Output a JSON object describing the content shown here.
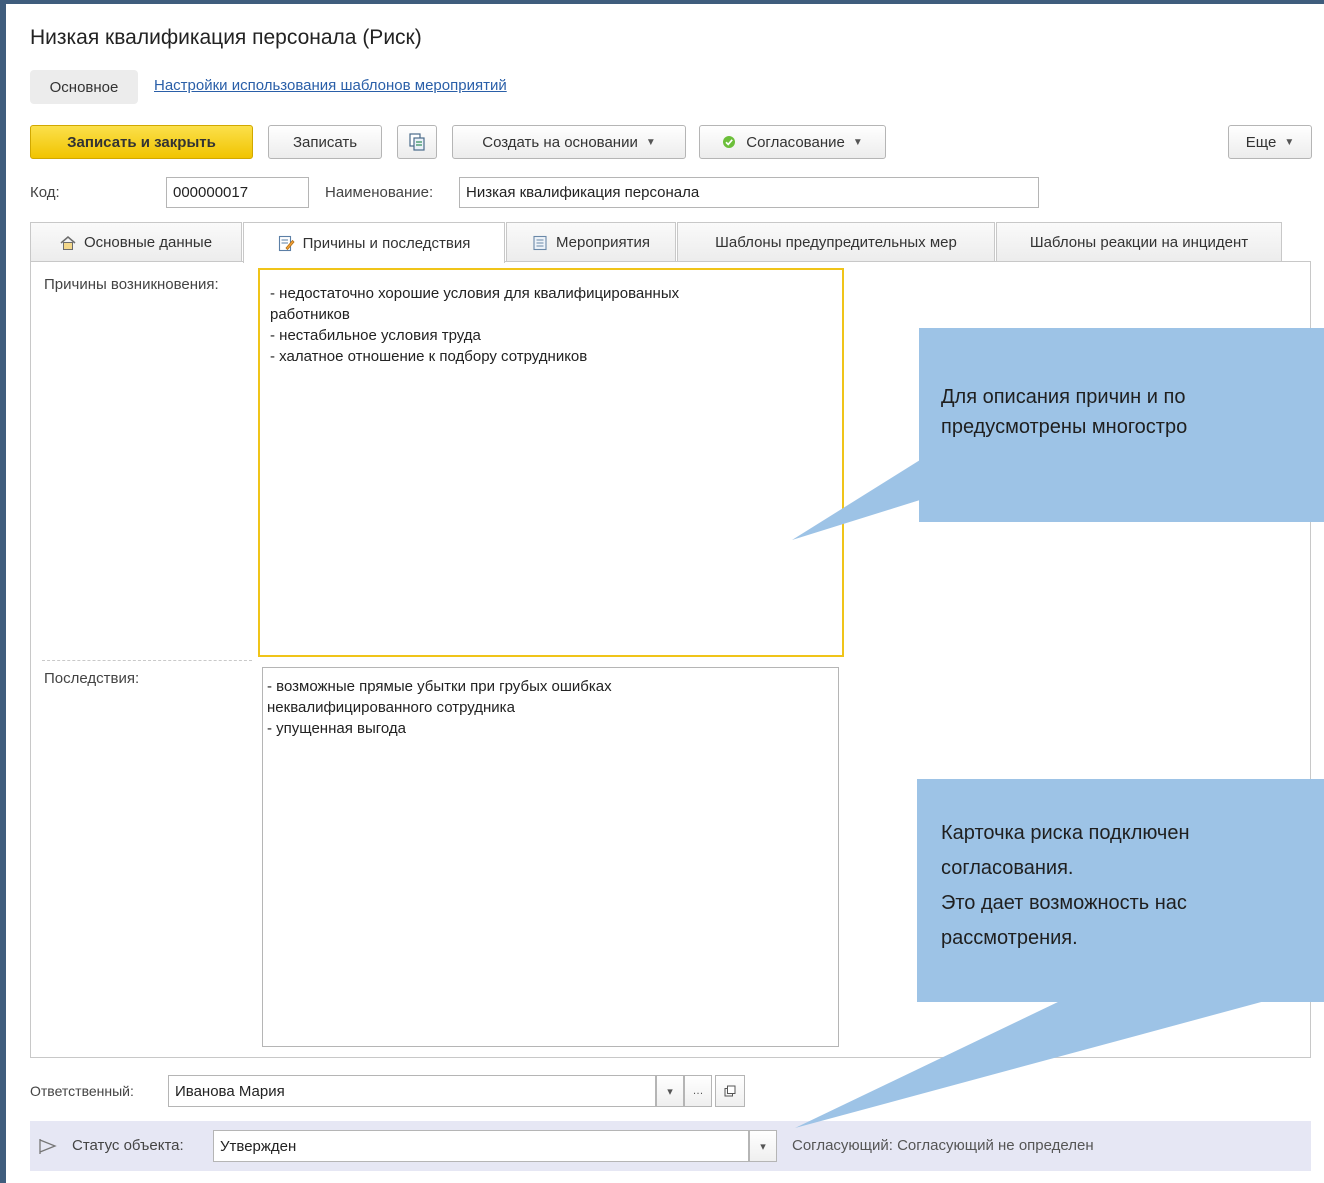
{
  "window": {
    "title": "Низкая квалификация персонала (Риск)"
  },
  "nav": {
    "active_tab": "Основное",
    "link": "Настройки использования шаблонов мероприятий"
  },
  "toolbar": {
    "save_close_label": "Записать и закрыть",
    "save_label": "Записать",
    "create_based_label": "Создать на основании",
    "approval_label": "Согласование",
    "more_label": "Еще"
  },
  "header_fields": {
    "code_label": "Код:",
    "code_value": "000000017",
    "name_label": "Наименование:",
    "name_value": "Низкая квалификация персонала"
  },
  "tabs": [
    {
      "label": "Основные данные",
      "icon": "house-icon"
    },
    {
      "label": "Причины и последствия",
      "icon": "edit-document-icon",
      "active": true
    },
    {
      "label": "Мероприятия",
      "icon": "list-document-icon"
    },
    {
      "label": "Шаблоны предупредительных мер"
    },
    {
      "label": "Шаблоны реакции на инцидент"
    }
  ],
  "causes": {
    "label": "Причины возникновения:",
    "text": "- недостаточно хорошие условия для квалифицированных\nработников\n- нестабильное условия труда\n- халатное отношение к подбору сотрудников"
  },
  "consequences": {
    "label": "Последствия:",
    "text": "- возможные прямые убытки при грубых ошибках\nнеквалифицированного сотрудника\n- упущенная выгода"
  },
  "responsible": {
    "label": "Ответственный:",
    "value": "Иванова Мария"
  },
  "status": {
    "label": "Статус объекта:",
    "value": "Утвержден",
    "approver": "Согласующий: Согласующий не определен"
  },
  "callouts": [
    {
      "lines": [
        "Для описания причин и по",
        "предусмотрены многостро"
      ]
    },
    {
      "lines": [
        "Карточка риска подключен",
        "согласования.",
        "Это дает возможность нас",
        "рассмотрения."
      ]
    }
  ],
  "colors": {
    "primary_button": "#f1c400",
    "active_field_border": "#f0c419",
    "callout_fill": "#9dc3e6",
    "link": "#2a5fa8",
    "status_bar": "#e6e7f4"
  }
}
